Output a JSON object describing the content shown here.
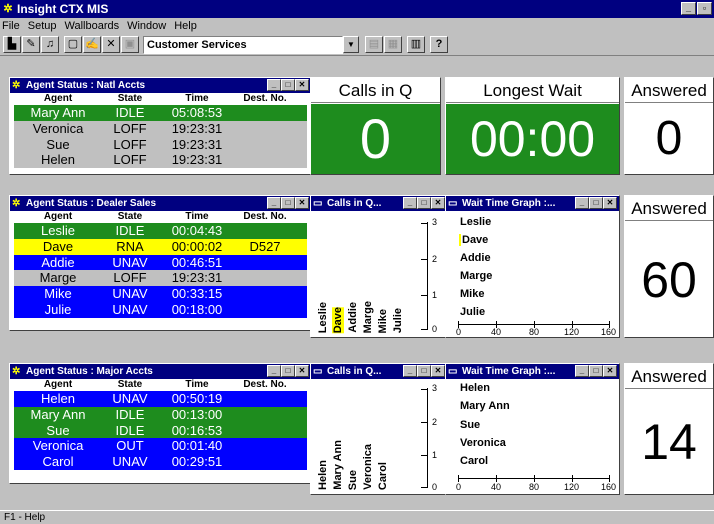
{
  "app": {
    "title": "Insight CTX MIS"
  },
  "menu": [
    "File",
    "Setup",
    "Wallboards",
    "Window",
    "Help"
  ],
  "toolbar": {
    "wallboard_select": "Customer Services"
  },
  "colors": {
    "idle": "#1e8c1e",
    "unav": "#0000ff",
    "rna": "#ffff00",
    "loff": "#c0c0c0",
    "titlebar": "#000080"
  },
  "agent_columns": {
    "agent": "Agent",
    "state": "State",
    "time": "Time",
    "dest": "Dest. No."
  },
  "natl": {
    "title": "Agent Status : Natl Accts",
    "rows": [
      {
        "agent": "Mary Ann",
        "state": "IDLE",
        "time": "05:08:53",
        "dest": ""
      },
      {
        "agent": "Veronica",
        "state": "LOFF",
        "time": "19:23:31",
        "dest": ""
      },
      {
        "agent": "Sue",
        "state": "LOFF",
        "time": "19:23:31",
        "dest": ""
      },
      {
        "agent": "Helen",
        "state": "LOFF",
        "time": "19:23:31",
        "dest": ""
      }
    ],
    "calls_in_q": {
      "label": "Calls in Q",
      "value": "0"
    },
    "longest_wait": {
      "label": "Longest Wait",
      "value": "00:00"
    },
    "answered": {
      "label": "Answered",
      "value": "0"
    }
  },
  "dealer": {
    "title": "Agent Status : Dealer Sales",
    "rows": [
      {
        "agent": "Leslie",
        "state": "IDLE",
        "time": "00:04:43",
        "dest": ""
      },
      {
        "agent": "Dave",
        "state": "RNA",
        "time": "00:00:02",
        "dest": "D527"
      },
      {
        "agent": "Addie",
        "state": "UNAV",
        "time": "00:46:51",
        "dest": ""
      },
      {
        "agent": "Marge",
        "state": "LOFF",
        "time": "19:23:31",
        "dest": ""
      },
      {
        "agent": "Mike",
        "state": "UNAV",
        "time": "00:33:15",
        "dest": ""
      },
      {
        "agent": "Julie",
        "state": "UNAV",
        "time": "00:18:00",
        "dest": ""
      }
    ],
    "callsq_title": "Calls in Q...",
    "callsq_names": [
      "Leslie",
      "Dave",
      "Addie",
      "Marge",
      "Mike",
      "Julie"
    ],
    "callsq_ticks": [
      "3",
      "2",
      "1",
      "0"
    ],
    "wait_title": "Wait Time Graph :...",
    "wait_names": [
      "Leslie",
      "Dave",
      "Addie",
      "Marge",
      "Mike",
      "Julie"
    ],
    "wait_ticks": [
      "0",
      "40",
      "80",
      "120",
      "160"
    ],
    "answered": {
      "label": "Answered",
      "value": "60"
    }
  },
  "major": {
    "title": "Agent Status : Major Accts",
    "rows": [
      {
        "agent": "Helen",
        "state": "UNAV",
        "time": "00:50:19",
        "dest": ""
      },
      {
        "agent": "Mary Ann",
        "state": "IDLE",
        "time": "00:13:00",
        "dest": ""
      },
      {
        "agent": "Sue",
        "state": "IDLE",
        "time": "00:16:53",
        "dest": ""
      },
      {
        "agent": "Veronica",
        "state": "OUT",
        "time": "00:01:40",
        "dest": ""
      },
      {
        "agent": "Carol",
        "state": "UNAV",
        "time": "00:29:51",
        "dest": ""
      }
    ],
    "callsq_title": "Calls in Q...",
    "callsq_names": [
      "Helen",
      "Mary Ann",
      "Sue",
      "Veronica",
      "Carol"
    ],
    "callsq_ticks": [
      "3",
      "2",
      "1",
      "0"
    ],
    "wait_title": "Wait Time Graph :...",
    "wait_names": [
      "Helen",
      "Mary Ann",
      "Sue",
      "Veronica",
      "Carol"
    ],
    "wait_ticks": [
      "0",
      "40",
      "80",
      "120",
      "160"
    ],
    "answered": {
      "label": "Answered",
      "value": "14"
    }
  },
  "status": {
    "text": "F1 - Help"
  }
}
